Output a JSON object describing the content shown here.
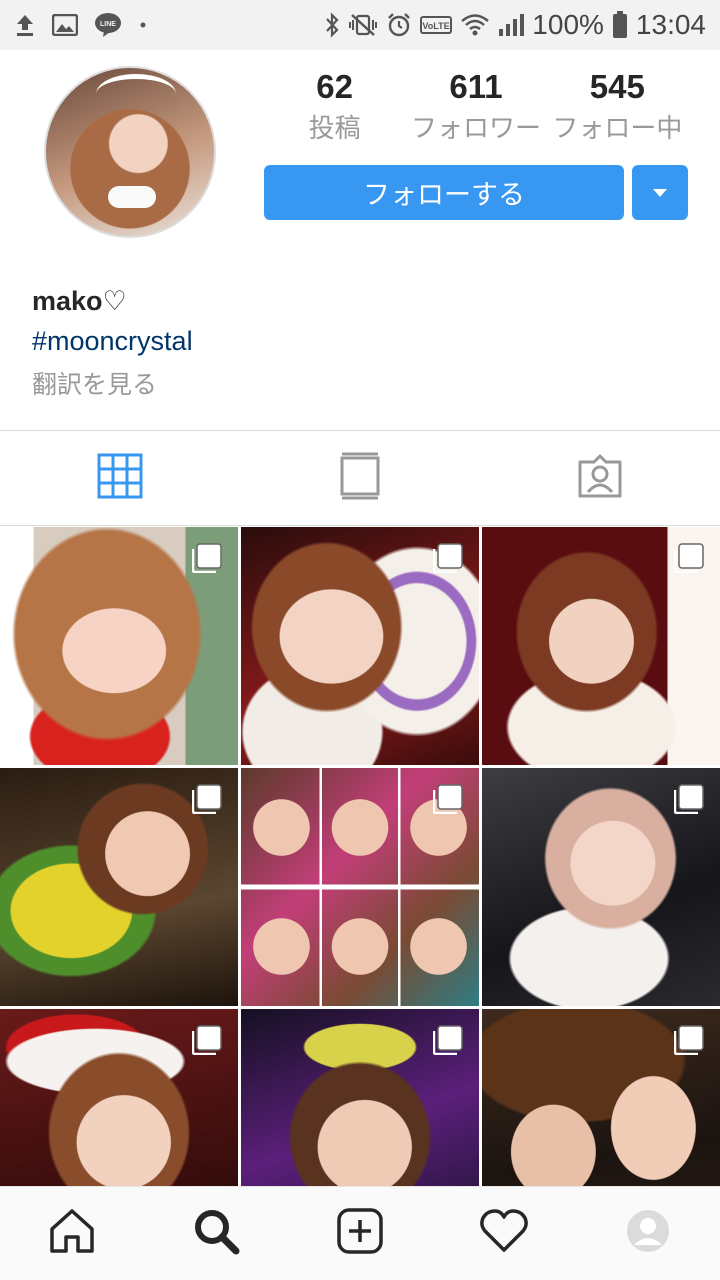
{
  "status_bar": {
    "battery": "100%",
    "time": "13:04",
    "left_icons": [
      "upload-icon",
      "image-icon",
      "line-icon",
      "dot-icon"
    ],
    "right_icons": [
      "bluetooth-icon",
      "vibrate-icon",
      "alarm-icon",
      "volte-icon",
      "wifi-icon",
      "signal-icon",
      "battery-icon"
    ]
  },
  "profile": {
    "stats": [
      {
        "value": "62",
        "label": "投稿"
      },
      {
        "value": "611",
        "label": "フォロワー"
      },
      {
        "value": "545",
        "label": "フォロー中"
      }
    ],
    "follow_label": "フォローする",
    "name": "mako♡",
    "hashtag": "#mooncrystal",
    "translate_label": "翻訳を見る"
  },
  "tabs": [
    {
      "icon": "grid-icon",
      "active": true
    },
    {
      "icon": "feed-icon",
      "active": false
    },
    {
      "icon": "tagged-icon",
      "active": false
    }
  ],
  "grid_posts": [
    {
      "row": 1,
      "col": 1,
      "multi": true
    },
    {
      "row": 1,
      "col": 2,
      "multi": true
    },
    {
      "row": 1,
      "col": 3,
      "multi": true
    },
    {
      "row": 2,
      "col": 1,
      "multi": true
    },
    {
      "row": 2,
      "col": 2,
      "multi": true
    },
    {
      "row": 2,
      "col": 3,
      "multi": true
    },
    {
      "row": 3,
      "col": 1,
      "multi": true
    },
    {
      "row": 3,
      "col": 2,
      "multi": true
    },
    {
      "row": 3,
      "col": 3,
      "multi": true
    }
  ],
  "bottom_nav": [
    "home-icon",
    "search-icon",
    "new-post-icon",
    "activity-icon",
    "profile-icon"
  ],
  "colors": {
    "accent": "#3897f0",
    "hashtag": "#003569",
    "muted": "#999999"
  }
}
